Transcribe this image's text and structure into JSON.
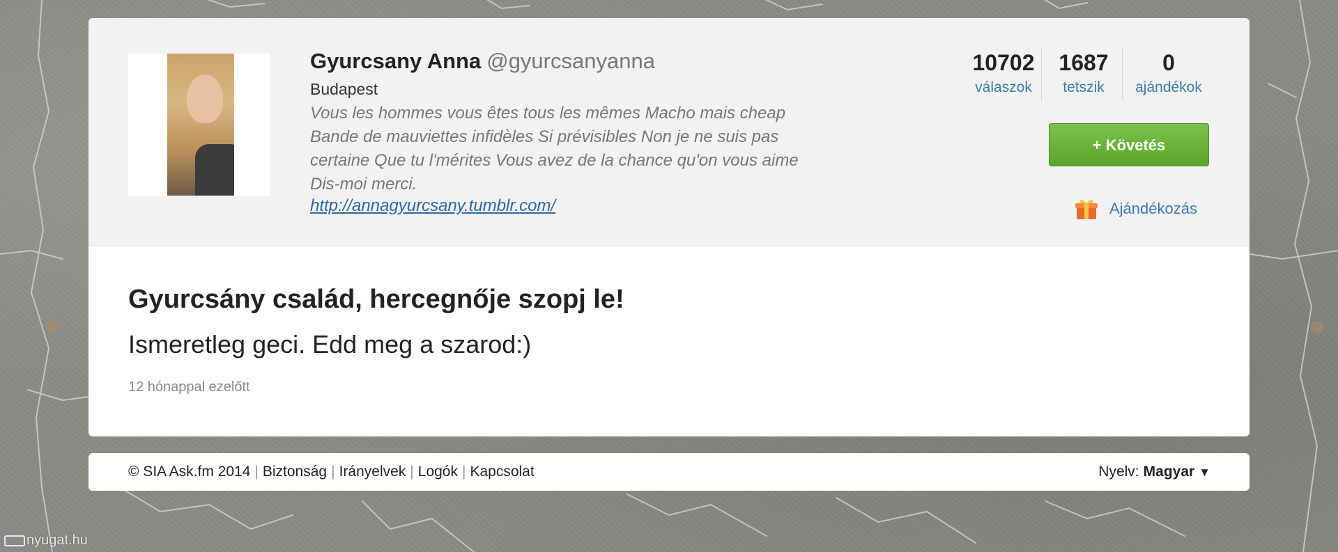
{
  "profile": {
    "name": "Gyurcsany Anna",
    "handle": "@gyurcsanyanna",
    "location": "Budapest",
    "bio": "Vous les hommes vous êtes tous les mêmes Macho mais cheap Bande de mauviettes infidèles Si prévisibles Non je ne suis pas certaine Que tu l'mérites Vous avez de la chance qu'on vous aime Dis-moi merci.",
    "link": "http://annagyurcsany.tumblr.com/"
  },
  "stats": [
    {
      "value": "10702",
      "label": "válaszok"
    },
    {
      "value": "1687",
      "label": "tetszik"
    },
    {
      "value": "0",
      "label": "ajándékok"
    }
  ],
  "actions": {
    "follow_label": "+ Követés",
    "gift_label": "Ajándékozás"
  },
  "post": {
    "question": "Gyurcsány család, hercegnője szopj le!",
    "answer": "Ismeretleg geci. Edd meg a szarod:)",
    "time": "12 hónappal ezelőtt"
  },
  "footer": {
    "copyright": "© SIA Ask.fm 2014",
    "links": [
      "Biztonság",
      "Irányelvek",
      "Logók",
      "Kapcsolat"
    ],
    "language_label": "Nyelv:",
    "language_value": "Magyar",
    "language_caret": "▼"
  },
  "watermark": "nyugat.hu",
  "colors": {
    "link_blue": "#3e7bb0",
    "follow_green": "#5aa52b",
    "header_bg": "#f2f2f2"
  },
  "icons": {
    "gift": "gift-icon",
    "avatar": "profile-photo",
    "watermark": "camera-icon"
  }
}
